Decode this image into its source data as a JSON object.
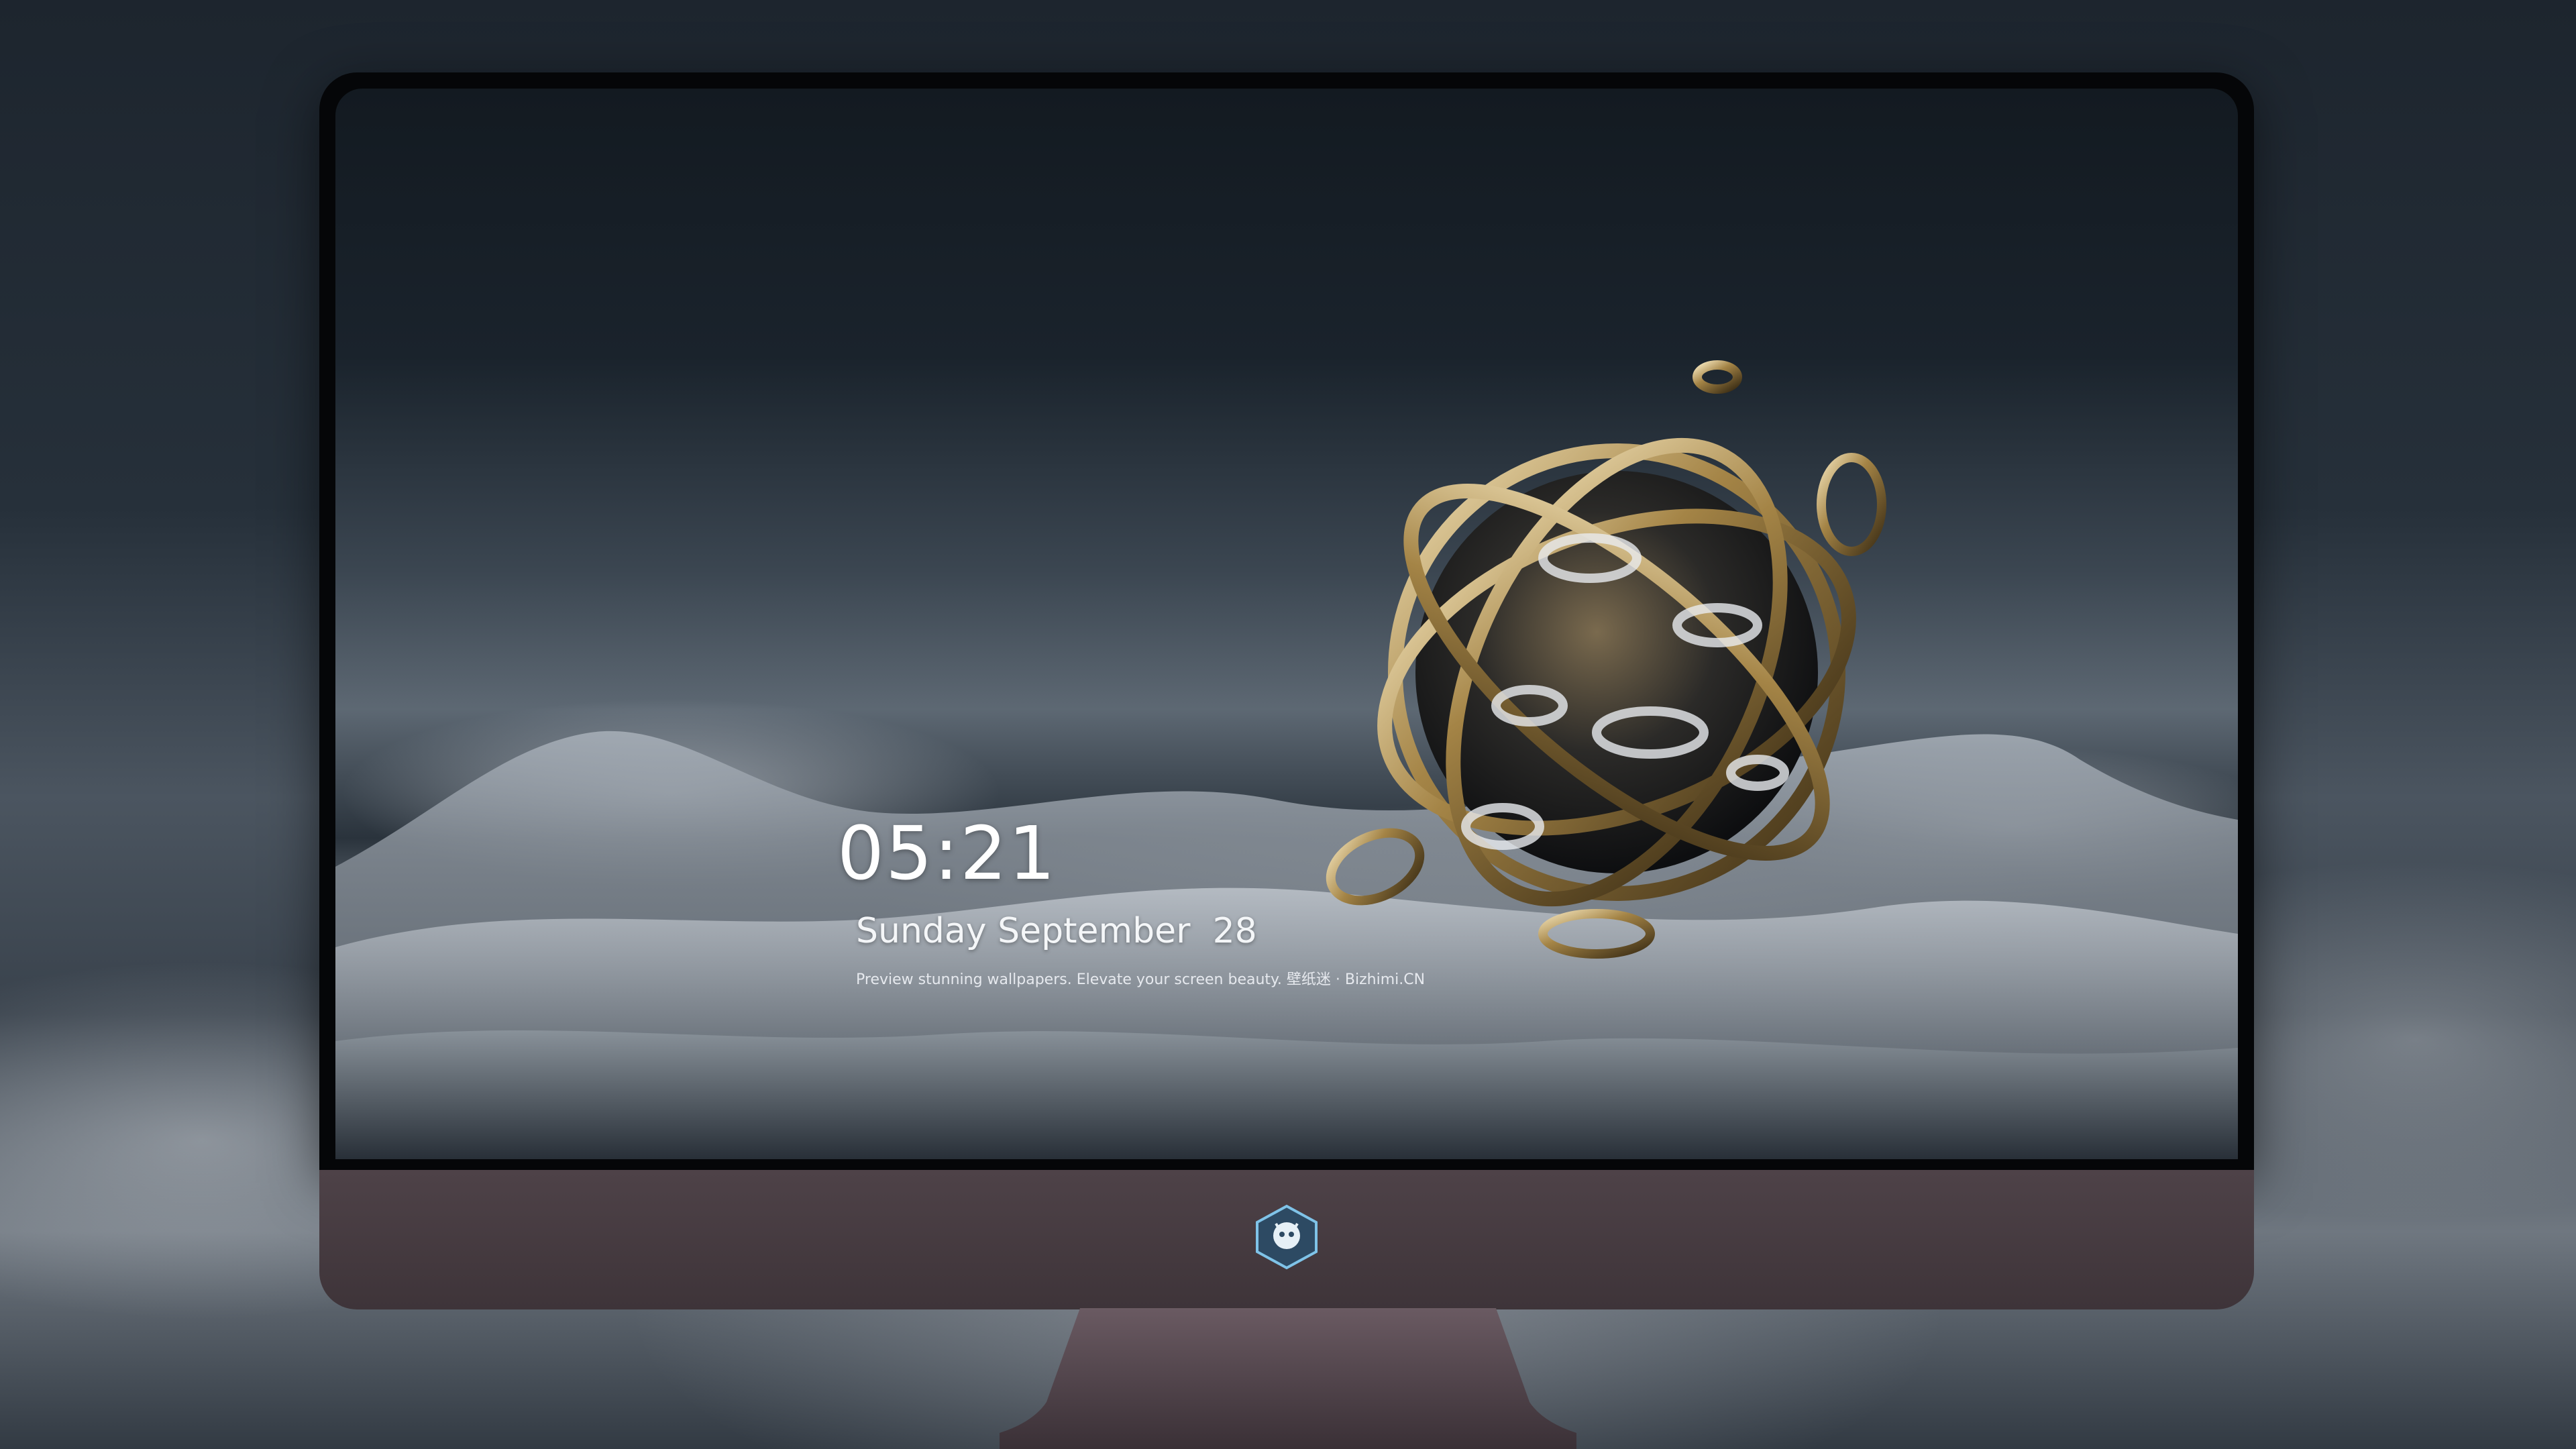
{
  "lock_screen": {
    "time": "05:21",
    "date": "Sunday September  28",
    "caption": "Preview stunning wallpapers. Elevate your screen beauty. 壁纸迷 · Bizhimi.CN"
  },
  "dock": {
    "apps": [
      {
        "name": "messages-icon",
        "color": "#2fcf4a"
      },
      {
        "name": "weather-icon",
        "color": "#2f8ff0"
      },
      {
        "name": "clock-icon",
        "color": "#f2f2f2"
      },
      {
        "name": "preview-icon",
        "color": "#f5c542"
      },
      {
        "name": "video-editor-icon",
        "color": "#4fc8e8"
      },
      {
        "name": "notes-icon",
        "color": "#ffd23f"
      },
      {
        "name": "photo-booth-icon",
        "color": "#e8eef2"
      },
      {
        "name": "music-icon",
        "color": "#e83ad1"
      },
      {
        "name": "app-store-icon",
        "color": "#1e86f5"
      },
      {
        "name": "camera-icon",
        "color": "#8a8f96"
      }
    ]
  },
  "colors": {
    "bezel": "#050608",
    "chin": "#4e4248",
    "wallpaper_dark": "#131a21"
  }
}
